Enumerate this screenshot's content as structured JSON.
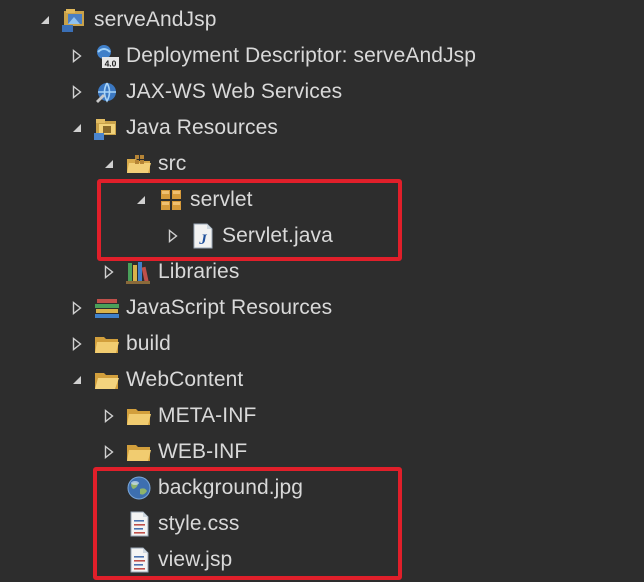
{
  "tree": [
    {
      "label": "serveAndJsp",
      "state": "expanded",
      "icon": "web-project-icon",
      "depth": 0
    },
    {
      "label": "Deployment Descriptor: serveAndJsp",
      "state": "collapsed",
      "icon": "deployment-descriptor-icon",
      "depth": 1
    },
    {
      "label": "JAX-WS Web Services",
      "state": "collapsed",
      "icon": "web-services-icon",
      "depth": 1
    },
    {
      "label": "Java Resources",
      "state": "expanded",
      "icon": "java-resources-icon",
      "depth": 1
    },
    {
      "label": "src",
      "state": "expanded",
      "icon": "source-folder-icon",
      "depth": 2
    },
    {
      "label": "servlet",
      "state": "expanded",
      "icon": "package-icon",
      "depth": 3
    },
    {
      "label": "Servlet.java",
      "state": "collapsed",
      "icon": "java-file-icon",
      "depth": 4
    },
    {
      "label": "Libraries",
      "state": "collapsed",
      "icon": "libraries-icon",
      "depth": 2
    },
    {
      "label": "JavaScript Resources",
      "state": "collapsed",
      "icon": "javascript-resources-icon",
      "depth": 1
    },
    {
      "label": "build",
      "state": "collapsed",
      "icon": "folder-icon",
      "depth": 1
    },
    {
      "label": "WebContent",
      "state": "expanded",
      "icon": "folder-open-icon",
      "depth": 1
    },
    {
      "label": "META-INF",
      "state": "collapsed",
      "icon": "folder-icon",
      "depth": 2
    },
    {
      "label": "WEB-INF",
      "state": "collapsed",
      "icon": "folder-icon",
      "depth": 2
    },
    {
      "label": "background.jpg",
      "state": "leaf",
      "icon": "image-file-icon",
      "depth": 2
    },
    {
      "label": "style.css",
      "state": "leaf",
      "icon": "text-file-icon",
      "depth": 2
    },
    {
      "label": "view.jsp",
      "state": "leaf",
      "icon": "text-file-icon",
      "depth": 2
    }
  ],
  "colors": {
    "background": "#2d2d2d",
    "text": "#d9d9d9",
    "highlight": "#e01f2a"
  }
}
